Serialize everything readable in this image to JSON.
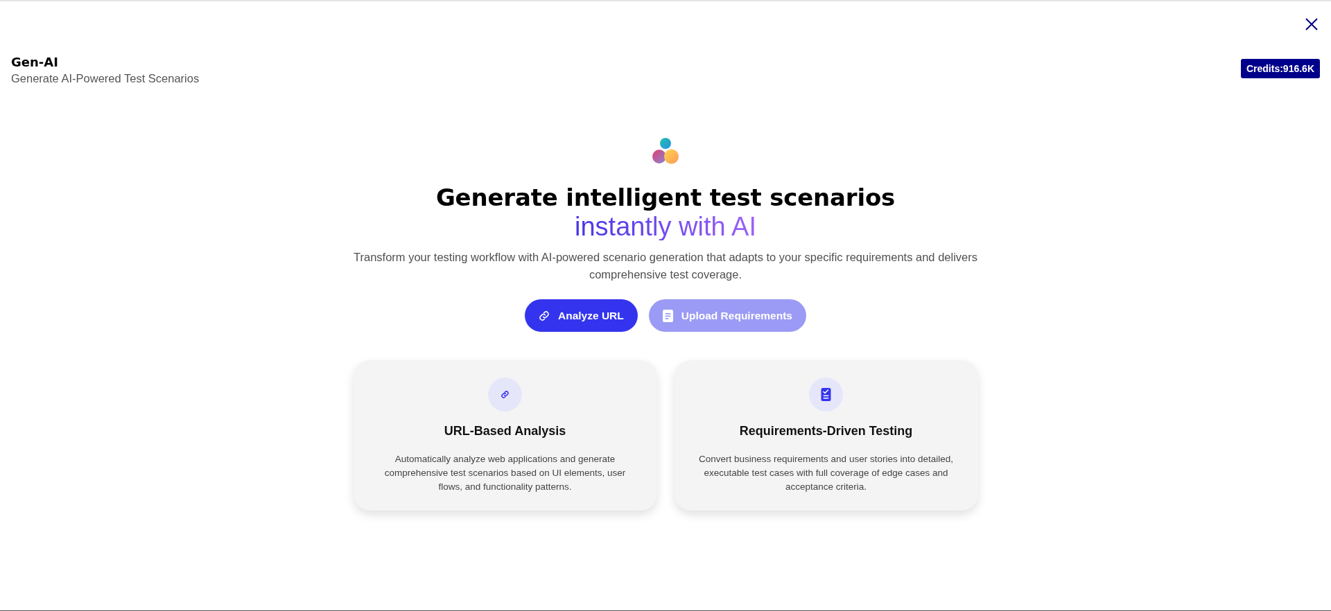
{
  "header": {
    "title": "Gen-AI",
    "subtitle": "Generate AI-Powered Test Scenarios",
    "credits": "Credits:916.6K"
  },
  "hero": {
    "heading": "Generate intelligent test scenarios",
    "heading_accent": "instantly with AI",
    "description": "Transform your testing workflow with AI-powered scenario generation that adapts to your specific requirements and delivers comprehensive test coverage."
  },
  "modes": [
    {
      "label": "Analyze URL",
      "kind": "link",
      "selected": true
    },
    {
      "label": "Upload Requirements",
      "kind": "document",
      "selected": false
    }
  ],
  "features": [
    {
      "kind": "link",
      "title": "URL-Based Analysis",
      "description": "Automatically analyze web applications and generate comprehensive test scenarios based on UI elements, user flows, and functionality patterns."
    },
    {
      "kind": "checklist",
      "title": "Requirements-Driven Testing",
      "description": "Convert business requirements and user stories into detailed, executable test cases with full coverage of edge cases and acceptance criteria."
    }
  ]
}
